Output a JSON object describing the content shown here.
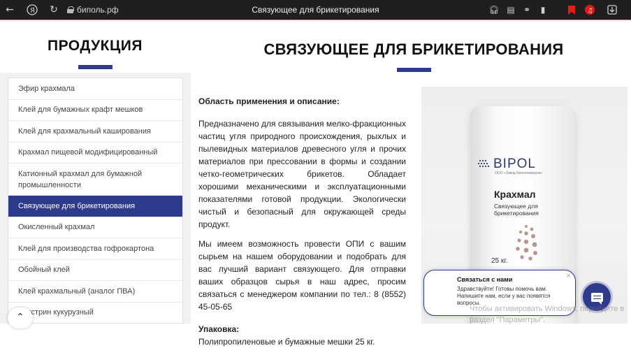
{
  "browser": {
    "address": "биполь.рф",
    "tab_title": "Связующее для брикетирования"
  },
  "sidebar": {
    "heading": "ПРОДУКЦИЯ",
    "items": [
      {
        "label": "Эфир крахмала"
      },
      {
        "label": "Клей для бумажных крафт мешков"
      },
      {
        "label": "Клей для крахмальный каширования"
      },
      {
        "label": "Крахмал пищевой модифицированный"
      },
      {
        "label": "Катионный крахмал для бумажной промышленности"
      },
      {
        "label": "Связующее для брикетирования"
      },
      {
        "label": "Окисленный крахмал"
      },
      {
        "label": "Клей для производства гофрокартона"
      },
      {
        "label": "Обойный клей"
      },
      {
        "label": "Клей крахмальный (аналог ПВА)"
      },
      {
        "label": "Декстрин кукурузный"
      }
    ],
    "active_index": 5
  },
  "main": {
    "heading": "СВЯЗУЮЩЕЕ ДЛЯ БРИКЕТИРОВАНИЯ",
    "section_label": "Область применения и описание:",
    "paragraph1": "Предназначено для связывания мелко-фракционных частиц угля природного происхождения, рыхлых и пылевидных материалов древесного угля и прочих материалов при прессовании в формы и создании четко-геометрических брикетов. Обладает хорошими механическими и эксплуатационными показателями готовой продукции. Экологически чистый и безопасный для окружающей среды продукт.",
    "paragraph2": "Мы имеем возможность провести ОПИ с вашим сырьем на нашем оборудовании и подобрать для вас лучший вариант связующего. Для отправки ваших образцов сырья в наш адрес, просим связаться с менеджером компании по тел.: 8 (8552) 45-05-65",
    "packaging_label": "Упаковка:",
    "packaging_text": "Полипропиленовые и бумажные мешки 25 кг."
  },
  "product_image": {
    "brand": "BIPOL",
    "brand_sub": "ООО «Завод Биополимеров»",
    "name": "Крахмал",
    "desc_line1": "Связующее для",
    "desc_line2": "брикетирования",
    "weight": "25 кг."
  },
  "chat": {
    "title": "Связаться с нами",
    "message": "Здравствуйте! Готовы помочь вам. Напишите нам, если у вас появятся вопросы.",
    "close": "×"
  },
  "watermark": {
    "line1": "Чтобы активировать Windows, перейдите в",
    "line2": "раздел \"Параметры\"."
  },
  "colors": {
    "accent": "#2e3b8c",
    "toolbar": "#1f1f1f"
  }
}
